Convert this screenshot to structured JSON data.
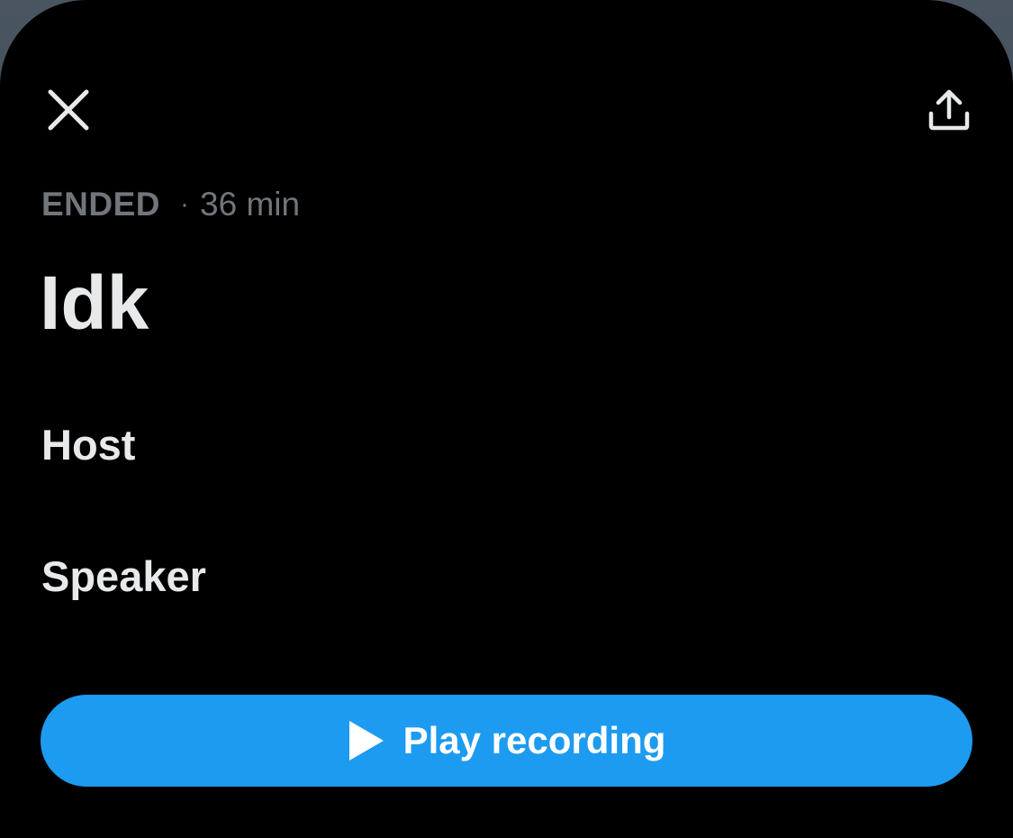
{
  "header": {
    "close_icon": "close-icon",
    "share_icon": "share-upload-icon"
  },
  "space": {
    "status": "ENDED",
    "separator": "·",
    "duration": "36 min",
    "title": "Idk"
  },
  "sections": {
    "host_label": "Host",
    "speaker_label": "Speaker"
  },
  "actions": {
    "play_label": "Play recording",
    "play_icon": "play-icon"
  },
  "colors": {
    "background": "#000000",
    "primary_text": "#e7e9ea",
    "secondary_text": "#71767b",
    "accent": "#1d9bf0"
  }
}
